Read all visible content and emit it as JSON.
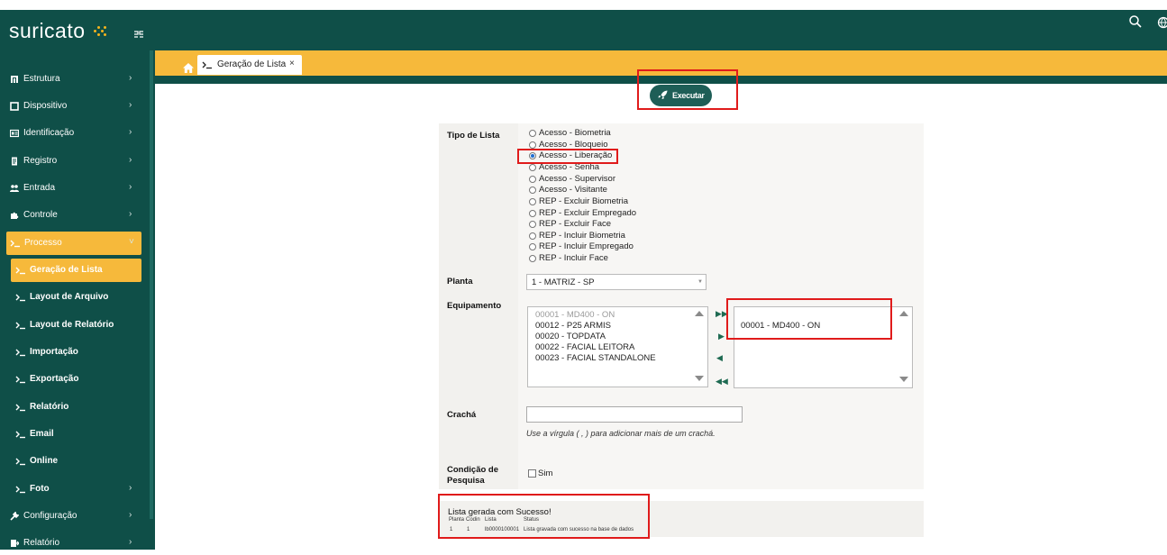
{
  "app": {
    "logo_text": "suricato",
    "brand_color": "#0f4f48",
    "accent_color": "#f6b93b"
  },
  "sidebar": {
    "items": [
      {
        "label": "Estrutura",
        "icon": "building-icon"
      },
      {
        "label": "Dispositivo",
        "icon": "square-icon"
      },
      {
        "label": "Identificação",
        "icon": "id-card-icon"
      },
      {
        "label": "Registro",
        "icon": "document-icon"
      },
      {
        "label": "Entrada",
        "icon": "people-icon"
      },
      {
        "label": "Controle",
        "icon": "puzzle-icon"
      },
      {
        "label": "Processo",
        "icon": "terminal-icon"
      },
      {
        "label": "Geração de Lista",
        "icon": "terminal-icon"
      },
      {
        "label": "Layout de Arquivo",
        "icon": "terminal-icon"
      },
      {
        "label": "Layout de Relatório",
        "icon": "terminal-icon"
      },
      {
        "label": "Importação",
        "icon": "terminal-icon"
      },
      {
        "label": "Exportação",
        "icon": "terminal-icon"
      },
      {
        "label": "Relatório",
        "icon": "terminal-icon"
      },
      {
        "label": "Email",
        "icon": "terminal-icon"
      },
      {
        "label": "Online",
        "icon": "terminal-icon"
      },
      {
        "label": "Foto",
        "icon": "terminal-icon"
      },
      {
        "label": "Configuração",
        "icon": "wrench-icon"
      },
      {
        "label": "Relatório",
        "icon": "report-icon"
      }
    ],
    "chevron_right": "›",
    "chevron_down": "˅"
  },
  "tabs": {
    "active_tab_label": "Geração de Lista",
    "close_label": "×"
  },
  "toolbar": {
    "execute_label": "Executar"
  },
  "form": {
    "tipo_label": "Tipo de Lista",
    "tipo_options": [
      "Acesso - Biometria",
      "Acesso - Bloqueio",
      "Acesso - Liberação",
      "Acesso - Senha",
      "Acesso - Supervisor",
      "Acesso - Visitante",
      "REP - Excluir Biometria",
      "REP - Excluir Empregado",
      "REP - Excluir Face",
      "REP - Incluir Biometria",
      "REP - Incluir Empregado",
      "REP - Incluir Face"
    ],
    "tipo_selected": "Acesso - Liberação",
    "planta_label": "Planta",
    "planta_value": "1 - MATRIZ - SP",
    "equip_label": "Equipamento",
    "equip_available": [
      "00001 - MD400 - ON",
      "00012 - P25 ARMIS",
      "00020 - TOPDATA",
      "00022 - FACIAL LEITORA",
      "00023 - FACIAL STANDALONE"
    ],
    "equip_selected": [
      "00001 - MD400 - ON"
    ],
    "move_all_right": "▶▶",
    "move_right": "▶",
    "move_left": "◀",
    "move_all_left": "◀◀",
    "cracha_label": "Crachá",
    "cracha_value": "",
    "cracha_hint": "Use a vírgula ( , ) para adicionar mais de um crachá.",
    "condicao_label_1": "Condição de",
    "condicao_label_2": "Pesquisa",
    "condicao_option": "Sim"
  },
  "result": {
    "message": "Lista gerada com Sucesso!",
    "columns": [
      "Planta",
      "Codin",
      "Lista",
      "Status"
    ],
    "rows": [
      [
        "1",
        "1",
        "lb0000100001",
        "Lista gravada com sucesso na base de dados"
      ]
    ]
  }
}
